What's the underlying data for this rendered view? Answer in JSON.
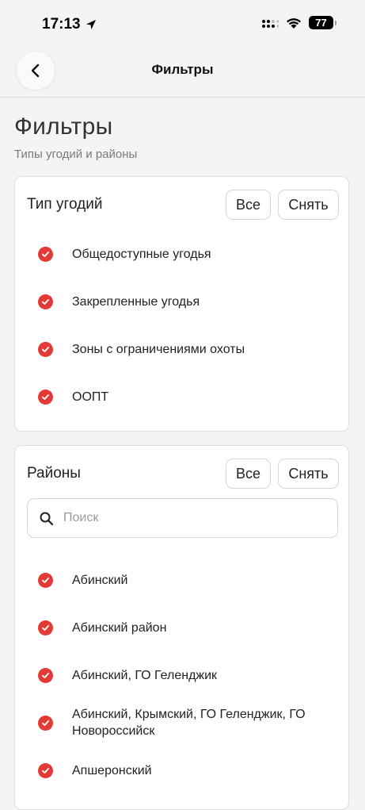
{
  "status_bar": {
    "time": "17:13",
    "battery": "77"
  },
  "nav": {
    "title": "Фильтры"
  },
  "page": {
    "title": "Фильтры",
    "subtitle": "Типы угодий и районы"
  },
  "land_types": {
    "title": "Тип угодий",
    "all_label": "Все",
    "clear_label": "Снять",
    "items": [
      {
        "label": "Общедоступные угодья",
        "checked": true
      },
      {
        "label": "Закрепленные угодья",
        "checked": true
      },
      {
        "label": "Зоны с ограничениями охоты",
        "checked": true
      },
      {
        "label": "ООПТ",
        "checked": true
      }
    ]
  },
  "districts": {
    "title": "Районы",
    "all_label": "Все",
    "clear_label": "Снять",
    "search": {
      "placeholder": "Поиск",
      "value": ""
    },
    "items": [
      {
        "label": "Абинский",
        "checked": true
      },
      {
        "label": "Абинский район",
        "checked": true
      },
      {
        "label": "Абинский, ГО Геленджик",
        "checked": true
      },
      {
        "label": "Абинский, Крымский, ГО Геленджик, ГО Новороссийск",
        "checked": true
      },
      {
        "label": "Апшеронский",
        "checked": true
      }
    ]
  },
  "colors": {
    "accent": "#e53935",
    "background": "#f4f4f4",
    "card": "#ffffff"
  }
}
